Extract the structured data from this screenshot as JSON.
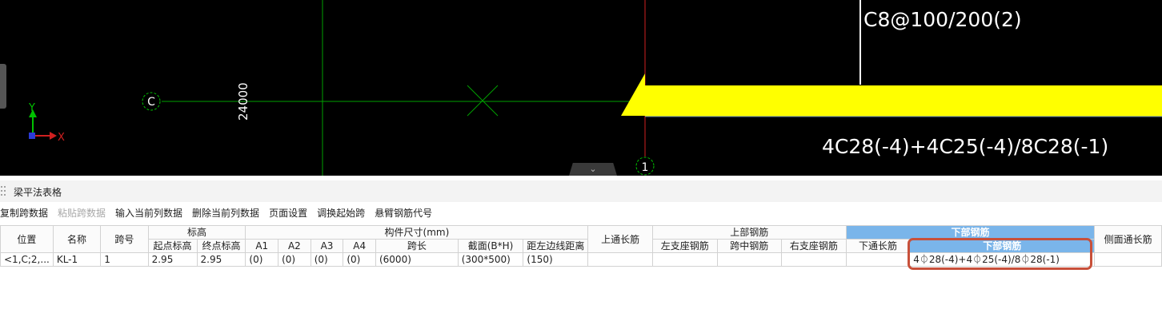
{
  "canvas": {
    "top_rebar_text": "C8@100/200(2)",
    "bottom_rebar_text": "4C28(-4)+4C25(-4)/8C28(-1)",
    "dimension_text": "24000",
    "axis_c_label": "C",
    "axis_1_label": "1",
    "ucs_y": "Y",
    "ucs_x": "X",
    "colors": {
      "background": "#000000",
      "beam": "#ffff00",
      "grid_green": "#00a000",
      "grid_red": "#d02020"
    }
  },
  "panel": {
    "title": "梁平法表格",
    "collapse_glyph": "⌄"
  },
  "toolbar": {
    "items": [
      "复制跨数据",
      "粘贴跨数据",
      "输入当前列数据",
      "删除当前列数据",
      "页面设置",
      "调换起始跨",
      "悬臂钢筋代号"
    ]
  },
  "table": {
    "groups": {
      "position": "位置",
      "name": "名称",
      "span_no": "跨号",
      "elevation": "标高",
      "size": "构件尺寸(mm)",
      "top_long": "上通长筋",
      "top_rebar": "上部钢筋",
      "bottom_rebar": "下部钢筋",
      "side_long": "侧面通长筋"
    },
    "subheaders": {
      "start_elev": "起点标高",
      "end_elev": "终点标高",
      "a1": "A1",
      "a2": "A2",
      "a3": "A3",
      "a4": "A4",
      "span_len": "跨长",
      "section": "截面(B*H)",
      "edge_dist": "距左边线距离",
      "left_support": "左支座钢筋",
      "mid_span": "跨中钢筋",
      "right_support": "右支座钢筋",
      "bottom_long": "下通长筋",
      "bottom_rebar": "下部钢筋"
    },
    "row": {
      "position": "<1,C;2,...",
      "name": "KL-1",
      "span_no": "1",
      "start_elev": "2.95",
      "end_elev": "2.95",
      "a1": "(0)",
      "a2": "(0)",
      "a3": "(0)",
      "a4": "(0)",
      "span_len": "(6000)",
      "section": "(300*500)",
      "edge_dist": "(150)",
      "top_long": "",
      "left_support": "",
      "mid_span": "",
      "right_support": "",
      "bottom_long": "",
      "bottom_rebar": "4⏀28(-4)+4⏀25(-4)/8⏀28(-1)",
      "side_long": ""
    },
    "selected_color": "#7ab5ea",
    "highlight_color": "#c8503a"
  }
}
